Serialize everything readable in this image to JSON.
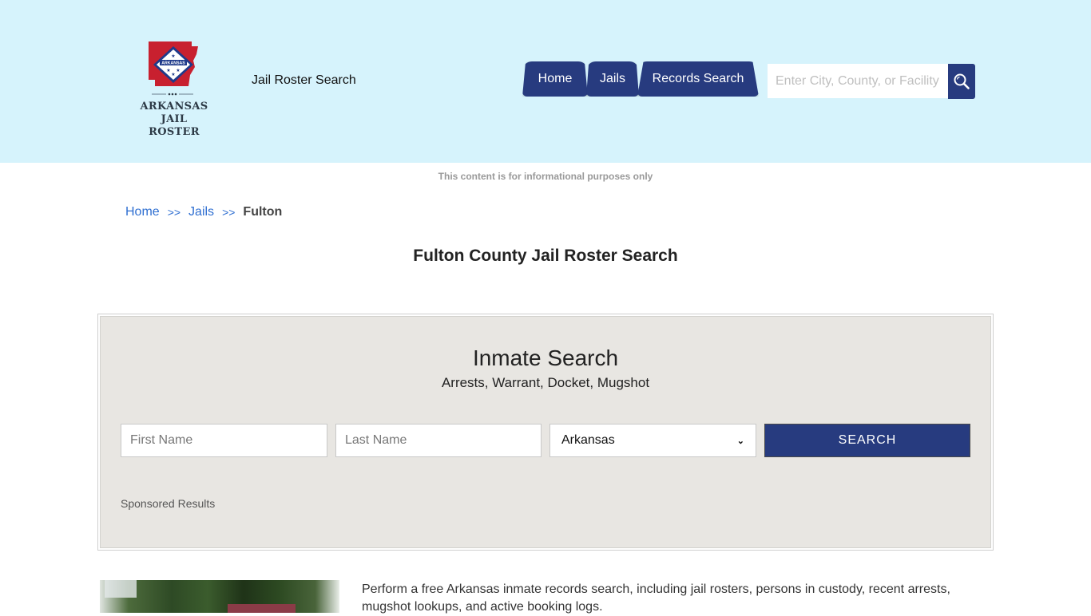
{
  "header": {
    "logo": {
      "state_label": "ARKANSAS",
      "line1": "ARKANSAS",
      "line2": "JAIL ROSTER"
    },
    "tagline": "Jail Roster Search",
    "nav": [
      {
        "label": "Home"
      },
      {
        "label": "Jails"
      },
      {
        "label": "Records Search"
      }
    ],
    "search": {
      "placeholder": "Enter City, County, or Facility",
      "icon": "search-icon"
    }
  },
  "disclaimer": "This content is for informational purposes only",
  "breadcrumb": {
    "items": [
      {
        "label": "Home"
      },
      {
        "label": "Jails"
      },
      {
        "label": "Fulton"
      }
    ],
    "separator": ">>"
  },
  "page_title": "Fulton County Jail Roster Search",
  "inmate_search": {
    "title": "Inmate Search",
    "subtitle": "Arrests, Warrant, Docket, Mugshot",
    "first_name_placeholder": "First Name",
    "last_name_placeholder": "Last Name",
    "state_selected": "Arkansas",
    "submit_label": "SEARCH",
    "sponsored_label": "Sponsored Results"
  },
  "intro_text": "Perform a free Arkansas inmate records search, including jail rosters, persons in custody, recent arrests, mugshot lookups, and active booking logs.",
  "colors": {
    "header_bg": "#d6f3fc",
    "primary": "#273b7f",
    "link": "#2f6fd1",
    "panel_bg": "#e8e6e2"
  }
}
